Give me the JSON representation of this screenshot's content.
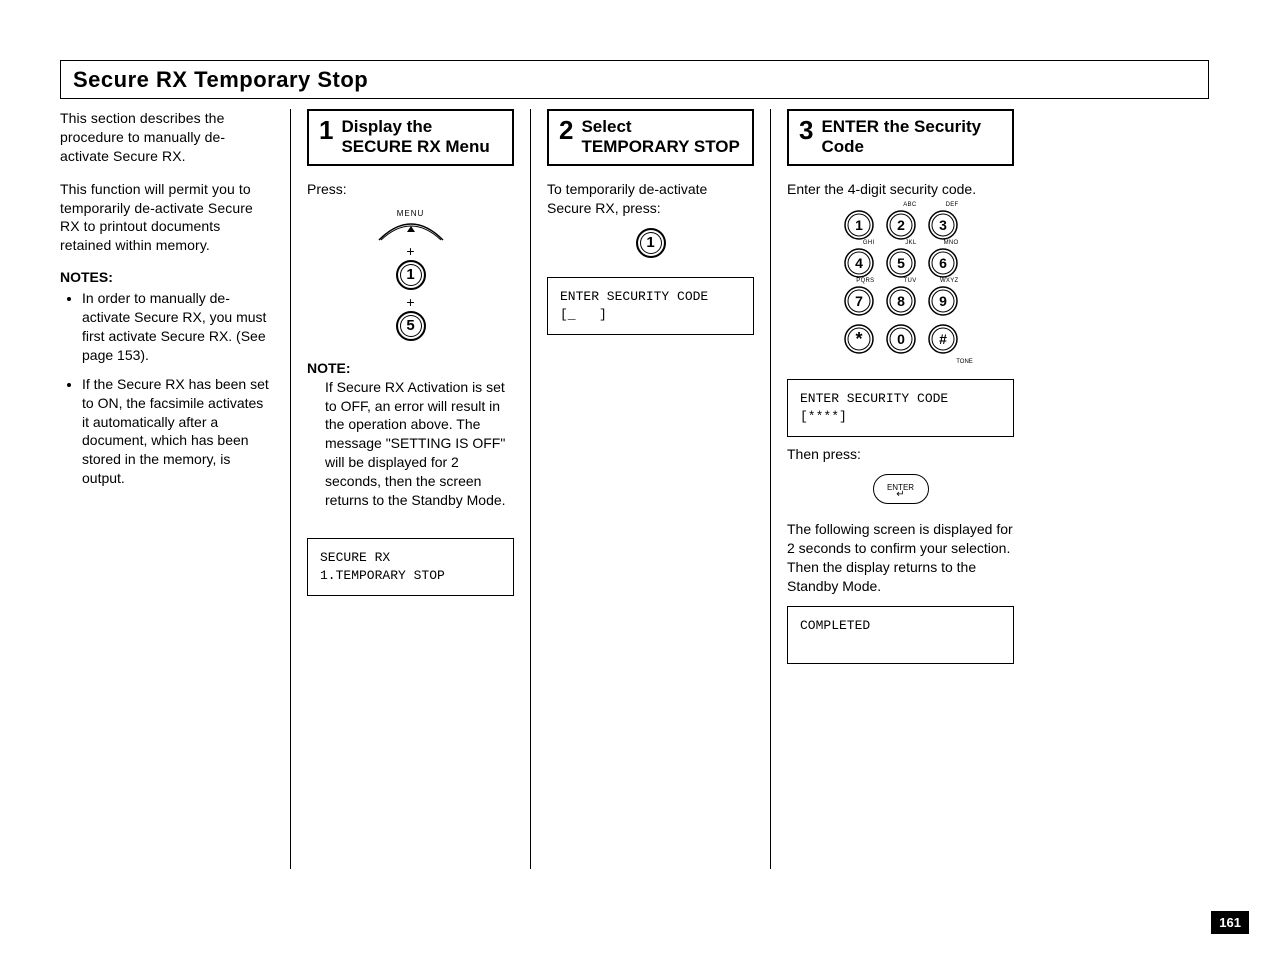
{
  "page_number": "161",
  "title": "Secure RX Temporary Stop",
  "intro": {
    "p1": "This section describes the procedure to manually de-activate Secure RX.",
    "p2": "This function will permit you to temporarily de-activate Secure RX to printout documents retained within memory.",
    "notes_heading": "NOTES:",
    "notes": [
      "In order to manually de-activate Secure RX, you must first activate Secure RX. (See page 153).",
      "If the Secure RX has been set to ON, the facsimile activates it automatically after a document, which has been stored in the memory, is output."
    ]
  },
  "steps": [
    {
      "num": "1",
      "title": "Display the SECURE RX Menu",
      "press_label": "Press:",
      "menu_label": "MENU",
      "key_top": "1",
      "key_bottom": "5",
      "note_label": "NOTE:",
      "note_body": "If Secure RX Activation is set to OFF, an error will result in the operation above. The message \"SETTING IS OFF\" will be displayed for 2 seconds, then the screen returns to the Standby Mode.",
      "lcd": "SECURE RX\n1.TEMPORARY STOP"
    },
    {
      "num": "2",
      "title": "Select TEMPORARY STOP",
      "intro": "To temporarily de-activate Secure RX, press:",
      "key": "1",
      "lcd": "ENTER SECURITY CODE\n[_   ]"
    },
    {
      "num": "3",
      "title": "ENTER the Security Code",
      "intro": "Enter the 4-digit security code.",
      "keypad_labels": {
        "abc": "ABC",
        "def": "DEF",
        "ghi": "GHI",
        "jkl": "JKL",
        "mno": "MNO",
        "pqrs": "PQRS",
        "tuv": "TUV",
        "wxyz": "WXYZ",
        "tone": "TONE"
      },
      "keys": [
        "1",
        "2",
        "3",
        "4",
        "5",
        "6",
        "7",
        "8",
        "9",
        "*",
        "0",
        "#"
      ],
      "lcd1": "ENTER SECURITY CODE\n[****]",
      "then_press": "Then press:",
      "enter_label": "ENTER",
      "after": "The following screen is displayed for 2 seconds to confirm your selection. Then the display returns to the Standby Mode.",
      "lcd2": "COMPLETED\n "
    }
  ]
}
